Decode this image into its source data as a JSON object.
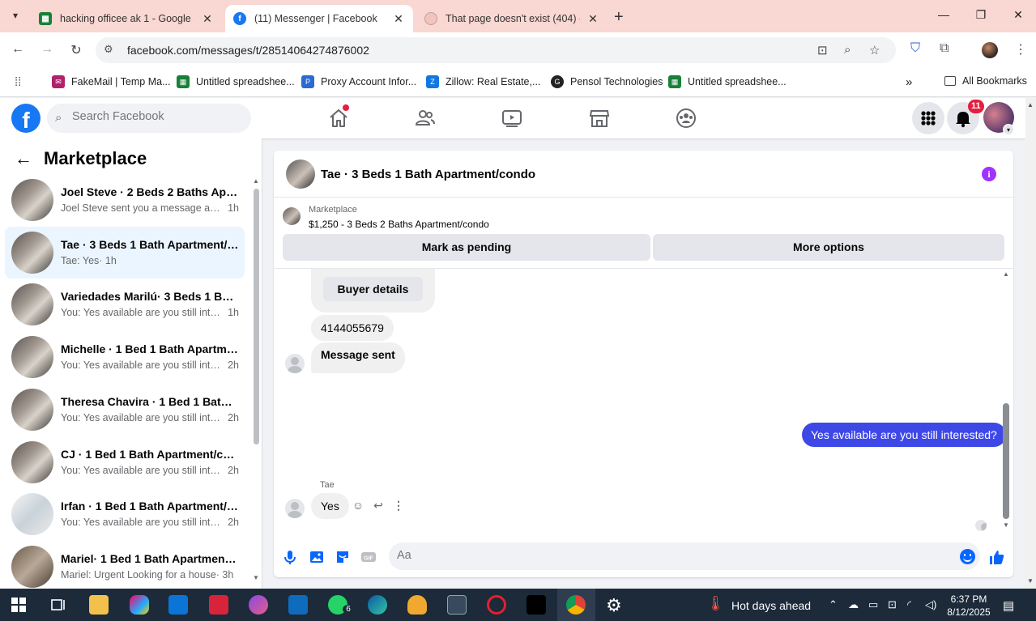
{
  "browser": {
    "tabs": [
      {
        "title": "hacking officee ak 1 - Google Sh",
        "favicon": "google-sheets-icon",
        "color": "#188038"
      },
      {
        "title": "(11) Messenger | Facebook",
        "favicon": "facebook-icon",
        "color": "#1877f2"
      },
      {
        "title": "That page doesn't exist (404) - F",
        "favicon": "facebook-icon",
        "color": "#c0c0c0"
      }
    ],
    "url": "facebook.com/messages/t/28514064274876002",
    "bookmarks": [
      {
        "label": "FakeMail | Temp Ma...",
        "icon": "fakemail-icon",
        "color": "#b0226b"
      },
      {
        "label": "Untitled spreadshee...",
        "icon": "google-sheets-icon",
        "color": "#188038"
      },
      {
        "label": "Proxy Account Infor...",
        "icon": "proxy-icon",
        "color": "#2b6ad1"
      },
      {
        "label": "Zillow: Real Estate,...",
        "icon": "zillow-icon",
        "color": "#1277e1"
      },
      {
        "label": "Pensol Technologies",
        "icon": "pensol-icon",
        "color": "#222222"
      },
      {
        "label": "Untitled spreadshee...",
        "icon": "google-sheets-icon",
        "color": "#188038"
      }
    ],
    "all_bookmarks": "All Bookmarks"
  },
  "facebook": {
    "search_placeholder": "Search Facebook",
    "notification_count": "11"
  },
  "sidebar": {
    "title": "Marketplace",
    "conversations": [
      {
        "title": "Joel Steve · 2 Beds 2 Baths Apartment/condo",
        "snippet": "Joel Steve sent you a message about your listing",
        "time": "1h",
        "active": false
      },
      {
        "title": "Tae · 3 Beds 1 Bath Apartment/condo",
        "snippet": "Tae: Yes",
        "time": "· 1h",
        "active": true
      },
      {
        "title": "Variedades Marilú· 3 Beds 1 Bath Apartment/condo",
        "snippet": "You: Yes available are you still interested?",
        "time": "1h",
        "active": false
      },
      {
        "title": "Michelle · 1 Bed 1 Bath Apartment/condo",
        "snippet": "You: Yes available are you still interested?",
        "time": "2h",
        "active": false
      },
      {
        "title": "Theresa Chavira · 1 Bed 1 Bath Apartment/condo",
        "snippet": "You: Yes available are you still interested?",
        "time": "2h",
        "active": false
      },
      {
        "title": "CJ · 1 Bed 1 Bath Apartment/condo",
        "snippet": "You: Yes available are you still interested?",
        "time": "2h",
        "active": false
      },
      {
        "title": "Irfan · 1 Bed 1 Bath Apartment/condo",
        "snippet": "You: Yes available are you still interested?",
        "time": "2h",
        "active": false
      },
      {
        "title": "Mariel· 1 Bed 1 Bath Apartment/condo",
        "snippet": "Mariel: Urgent Looking for a house",
        "time": "· 3h",
        "active": false
      }
    ]
  },
  "chat": {
    "title": "Tae · 3 Beds 1 Bath Apartment/condo",
    "listing_source": "Marketplace",
    "listing_desc": "$1,250 - 3 Beds 2 Baths Apartment/condo",
    "mark_pending": "Mark as pending",
    "more_options": "More options",
    "buyer_details": "Buyer details",
    "phone": "4144055679",
    "message_sent": "Message sent",
    "outgoing": "Yes available are you still interested?",
    "sender_name": "Tae",
    "incoming": "Yes",
    "composer_placeholder": "Aa",
    "accent": "#3e48e6"
  },
  "taskbar": {
    "weather": "Hot days ahead",
    "time": "6:37 PM",
    "date": "8/12/2025",
    "whatsapp_badge": "6"
  }
}
